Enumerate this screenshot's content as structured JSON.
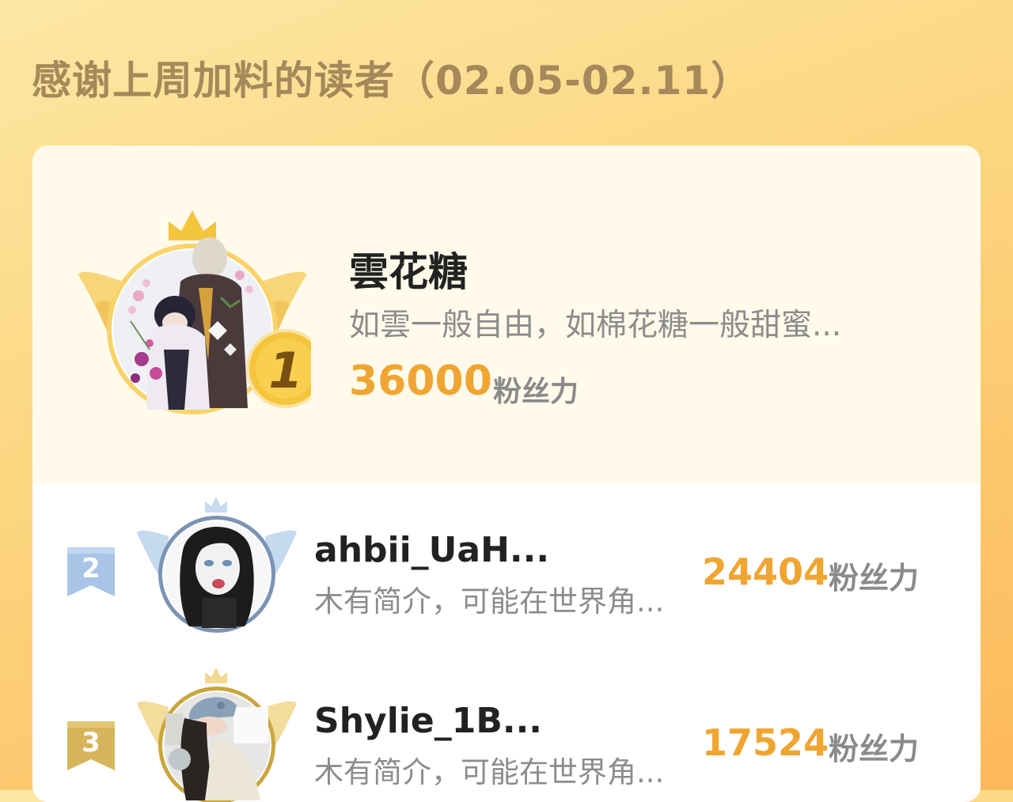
{
  "title": "感谢上周加料的读者（02.05-02.11）",
  "colors": {
    "score": "#f0a532",
    "gold": "#f5c43d",
    "silver": "#a8c4e6",
    "bronze": "#d6b55a"
  },
  "readers": [
    {
      "rank": "1",
      "name": "雲花糖",
      "intro": "如雲一般自由，如棉花糖一般甜蜜...",
      "score": "36000",
      "unit": "粉丝力",
      "badge_icon": "crown-wings-icon"
    },
    {
      "rank": "2",
      "name": "ahbii_UaH...",
      "intro": "木有简介，可能在世界角...",
      "score": "24404",
      "unit": "粉丝力",
      "badge_icon": "rank-ribbon-icon"
    },
    {
      "rank": "3",
      "name": "Shylie_1B...",
      "intro": "木有简介，可能在世界角...",
      "score": "17524",
      "unit": "粉丝力",
      "badge_icon": "rank-ribbon-icon"
    }
  ]
}
